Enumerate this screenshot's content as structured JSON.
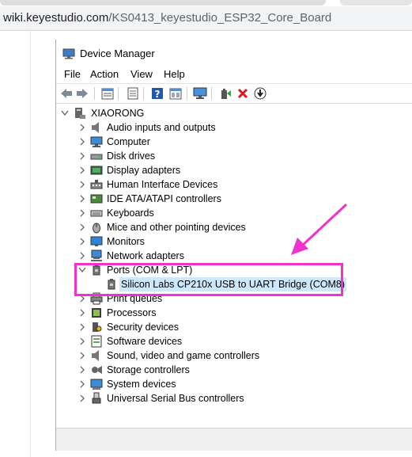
{
  "browser": {
    "url_host": "wiki.keyestudio.com",
    "url_path": "/KS0413_keyestudio_ESP32_Core_Board"
  },
  "window": {
    "title": "Device Manager",
    "menu": [
      "File",
      "Action",
      "View",
      "Help"
    ],
    "toolbar_icons": [
      "back-arrow-icon",
      "forward-arrow-icon",
      "properties-icon",
      "show-hide-icon",
      "help-icon",
      "view-icon",
      "monitor-scan-icon",
      "update-driver-icon",
      "uninstall-icon",
      "disable-device-icon"
    ]
  },
  "tree": {
    "root": "XIAORONG",
    "items": [
      {
        "label": "Audio inputs and outputs",
        "icon": "speaker-icon"
      },
      {
        "label": "Computer",
        "icon": "computer-icon"
      },
      {
        "label": "Disk drives",
        "icon": "disk-drive-icon"
      },
      {
        "label": "Display adapters",
        "icon": "display-adapter-icon"
      },
      {
        "label": "Human Interface Devices",
        "icon": "hid-icon"
      },
      {
        "label": "IDE ATA/ATAPI controllers",
        "icon": "ide-controller-icon"
      },
      {
        "label": "Keyboards",
        "icon": "keyboard-icon"
      },
      {
        "label": "Mice and other pointing devices",
        "icon": "mouse-icon"
      },
      {
        "label": "Monitors",
        "icon": "monitor-icon"
      },
      {
        "label": "Network adapters",
        "icon": "network-adapter-icon"
      },
      {
        "label": "Ports (COM & LPT)",
        "icon": "port-icon",
        "expanded": true,
        "children": [
          {
            "label": "Silicon Labs CP210x USB to UART Bridge (COM8)",
            "icon": "port-icon",
            "selected": true
          }
        ]
      },
      {
        "label": "Print queues",
        "icon": "printer-icon"
      },
      {
        "label": "Processors",
        "icon": "processor-icon"
      },
      {
        "label": "Security devices",
        "icon": "security-icon"
      },
      {
        "label": "Software devices",
        "icon": "software-device-icon"
      },
      {
        "label": "Sound, video and game controllers",
        "icon": "speaker-icon"
      },
      {
        "label": "Storage controllers",
        "icon": "storage-controller-icon"
      },
      {
        "label": "System devices",
        "icon": "system-device-icon"
      },
      {
        "label": "Universal Serial Bus controllers",
        "icon": "usb-icon"
      }
    ]
  },
  "colors": {
    "highlight_box": "#ee33cc",
    "arrow": "#ee33cc",
    "selection": "#cce8ff"
  }
}
